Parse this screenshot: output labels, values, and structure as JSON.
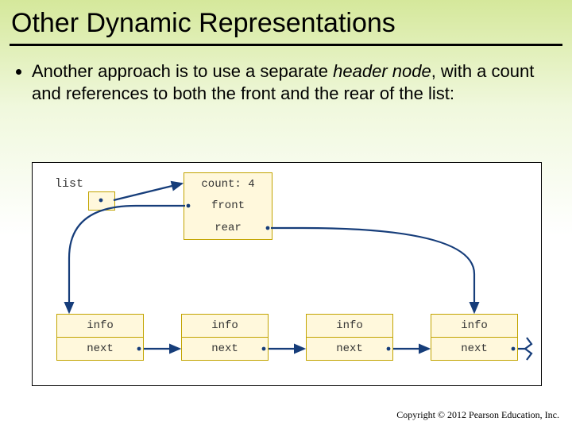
{
  "title": "Other Dynamic Representations",
  "bullet_prefix": "Another approach is to use a separate ",
  "bullet_em": "header node",
  "bullet_suffix": ", with a count and references to both the front and the rear of the list:",
  "list_label": "list",
  "header": {
    "count": "count: 4",
    "front": "front",
    "rear": "rear"
  },
  "node": {
    "info": "info",
    "next": "next"
  },
  "copyright": "Copyright © 2012 Pearson Education, Inc."
}
